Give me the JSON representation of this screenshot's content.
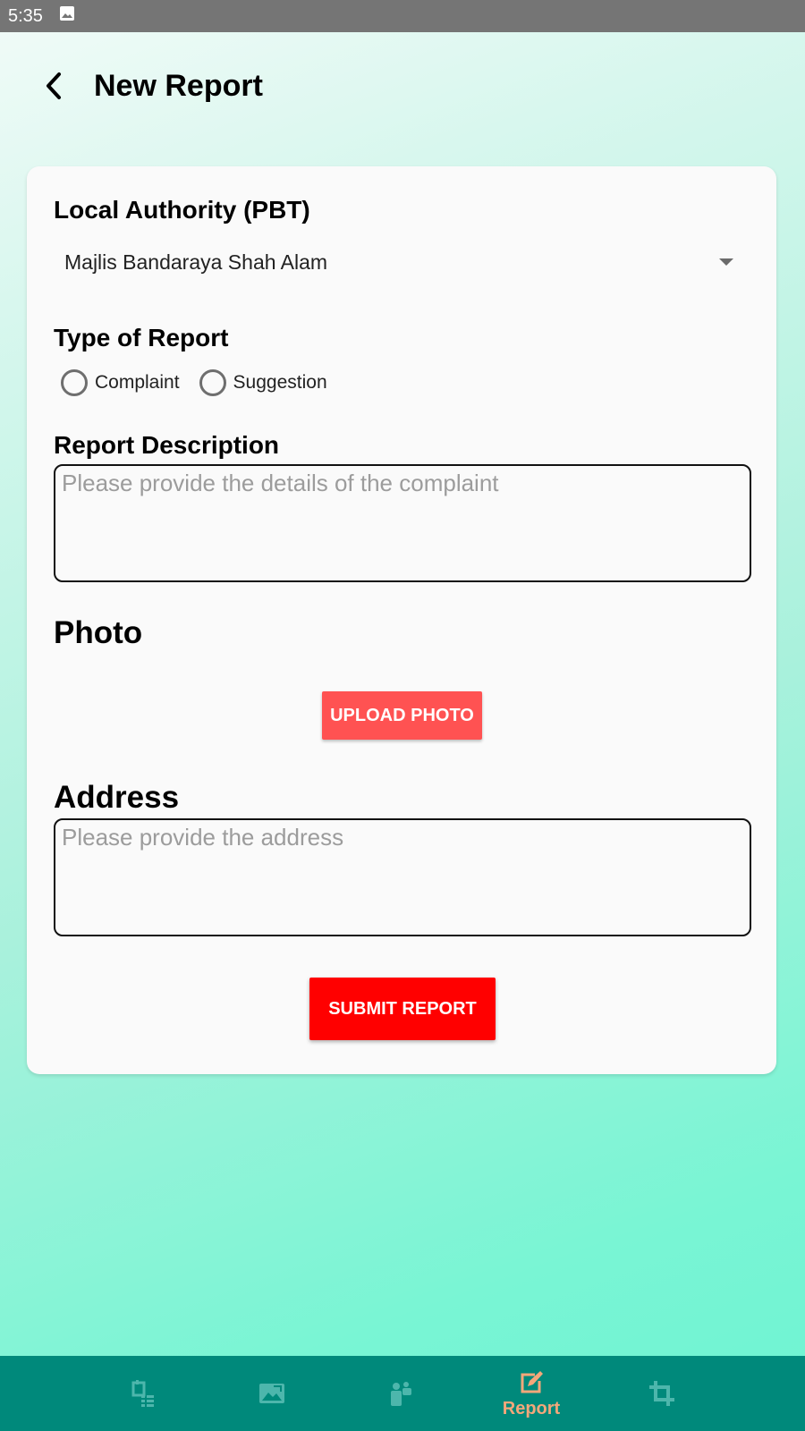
{
  "status_bar": {
    "time": "5:35",
    "notification_icon": "image-icon"
  },
  "header": {
    "title": "New Report",
    "back_icon": "back-arrow-icon"
  },
  "form": {
    "local_authority": {
      "label": "Local Authority (PBT)",
      "selected_value": "Majlis Bandaraya Shah Alam"
    },
    "report_type": {
      "label": "Type of Report",
      "options": [
        {
          "label": "Complaint",
          "selected": false
        },
        {
          "label": "Suggestion",
          "selected": false
        }
      ]
    },
    "description": {
      "label": "Report Description",
      "value": "",
      "placeholder": "Please provide the details of the complaint"
    },
    "photo": {
      "label": "Photo",
      "upload_label": "UPLOAD PHOTO"
    },
    "address": {
      "label": "Address",
      "value": "",
      "placeholder": "Please provide the address"
    },
    "submit_label": "SUBMIT REPORT"
  },
  "bottom_nav": {
    "items": [
      {
        "icon": "list-schedule-icon",
        "label": "",
        "active": false
      },
      {
        "icon": "image-landscape-icon",
        "label": "",
        "active": false
      },
      {
        "icon": "people-icon",
        "label": "",
        "active": false
      },
      {
        "icon": "report-edit-icon",
        "label": "Report",
        "active": true
      },
      {
        "icon": "crop-icon",
        "label": "",
        "active": false
      }
    ]
  },
  "colors": {
    "nav_background": "#00897b",
    "active_nav": "#f4a77a",
    "inactive_nav": "#4db6ac",
    "upload_button": "#ff5252",
    "submit_button": "#ff0000"
  }
}
